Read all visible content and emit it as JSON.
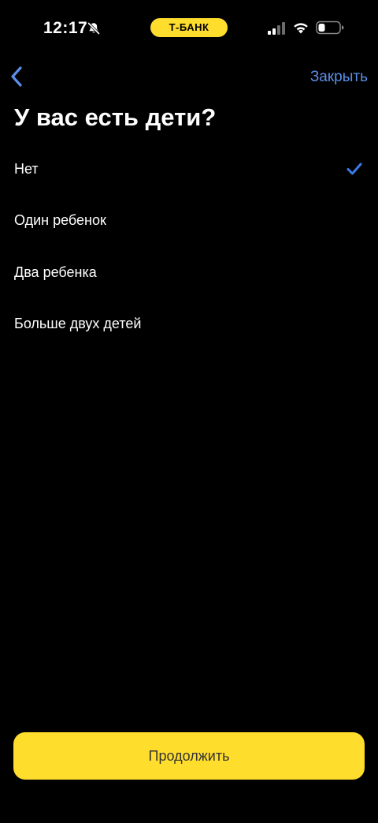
{
  "status_bar": {
    "time": "12:17",
    "app_pill_label": "Т-БАНК"
  },
  "nav": {
    "close_label": "Закрыть"
  },
  "title": "У вас есть дети?",
  "options": [
    {
      "label": "Нет",
      "selected": true
    },
    {
      "label": "Один ребенок",
      "selected": false
    },
    {
      "label": "Два ребенка",
      "selected": false
    },
    {
      "label": "Больше двух детей",
      "selected": false
    }
  ],
  "continue_label": "Продолжить",
  "colors": {
    "accent_yellow": "#ffdd2d",
    "link_blue": "#5b8fe8",
    "check_blue": "#3a7be8",
    "background": "#000000"
  },
  "icons": {
    "back": "chevron-left-icon",
    "selected": "checkmark-icon",
    "muted": "bell-slash-icon",
    "signal": "cellular-signal-icon",
    "wifi": "wifi-icon",
    "battery": "battery-icon"
  }
}
